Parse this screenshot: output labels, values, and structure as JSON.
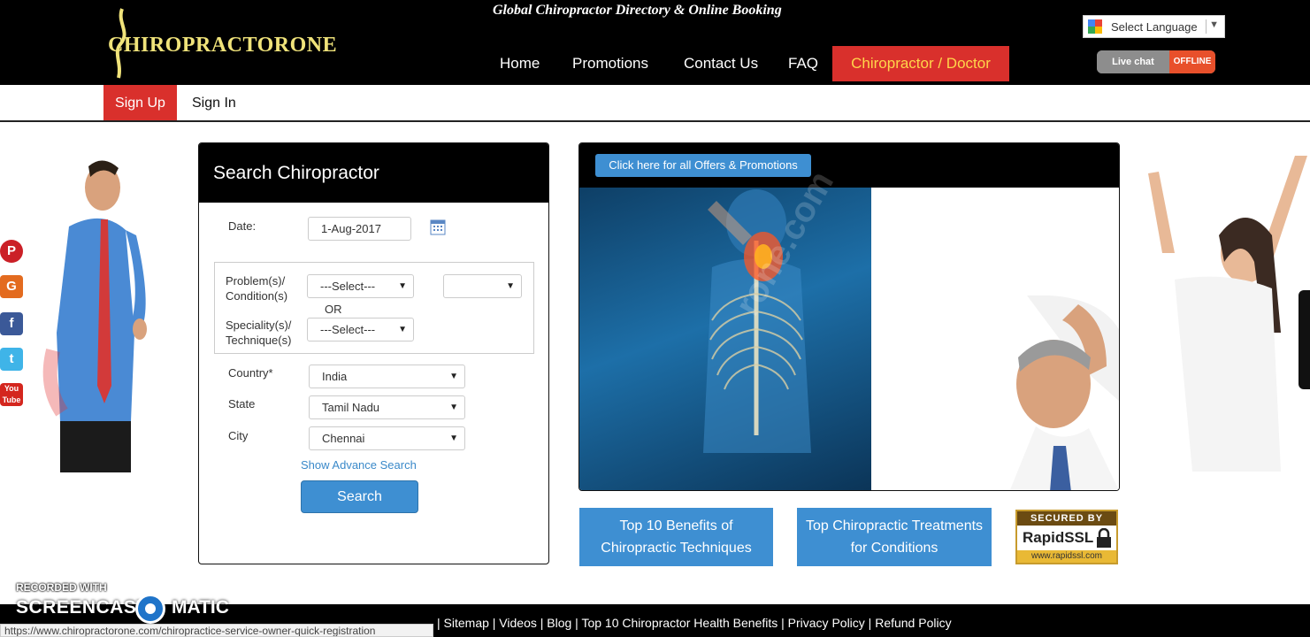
{
  "header": {
    "logo_text": "CHIROPRACTORONE",
    "tagline": "Global Chiropractor Directory & Online Booking",
    "nav": [
      "Home",
      "Promotions",
      "Contact Us",
      "FAQ"
    ],
    "cta": "Chiropractor / Doctor",
    "language": "Select Language",
    "livechat": "Live chat",
    "livechat_status": "OFFLINE"
  },
  "subnav": {
    "signup": "Sign Up",
    "signin": "Sign In"
  },
  "search": {
    "title": "Search Chiropractor",
    "date_label": "Date:",
    "date_value": "1-Aug-2017",
    "problem_label_1": "Problem(s)/",
    "problem_label_2": "Condition(s)",
    "problem_value": "---Select---",
    "or_label": "OR",
    "speciality_label_1": "Speciality(s)/",
    "speciality_label_2": "Technique(s)",
    "speciality_value": "---Select---",
    "country_label": "Country*",
    "country_value": "India",
    "state_label": "State",
    "state_value": "Tamil Nadu",
    "city_label": "City",
    "city_value": "Chennai",
    "advance_link": "Show Advance Search",
    "button": "Search"
  },
  "promo": {
    "offers_button": "Click here for all Offers & Promotions",
    "watermark": "rone.com"
  },
  "cards": {
    "benefits_line1": "Top 10 Benefits of",
    "benefits_line2": "Chiropractic Techniques",
    "treatments_line1": "Top Chiropractic Treatments",
    "treatments_line2": "for Conditions"
  },
  "ssl": {
    "top": "SECURED BY",
    "brand": "RapidSSL",
    "url": "www.rapidssl.com"
  },
  "footer": {
    "links": "| Sitemap | Videos | Blog | Top 10 Chiropractor Health Benefits | Privacy Policy | Refund Policy"
  },
  "status_bar": {
    "url": "https://www.chiropractorone.com/chiropractice-service-owner-quick-registration"
  },
  "recorder": {
    "line1": "RECORDED WITH",
    "brand_left": "SCREENCAST",
    "brand_right": "MATIC"
  },
  "icons": {
    "social": [
      "pinterest-icon",
      "google-icon",
      "facebook-icon",
      "twitter-icon",
      "youtube-icon"
    ],
    "calendar": "calendar-icon"
  },
  "colors": {
    "accent_red": "#d9302c",
    "accent_blue": "#3e8fd2",
    "header_bg": "#000000"
  }
}
